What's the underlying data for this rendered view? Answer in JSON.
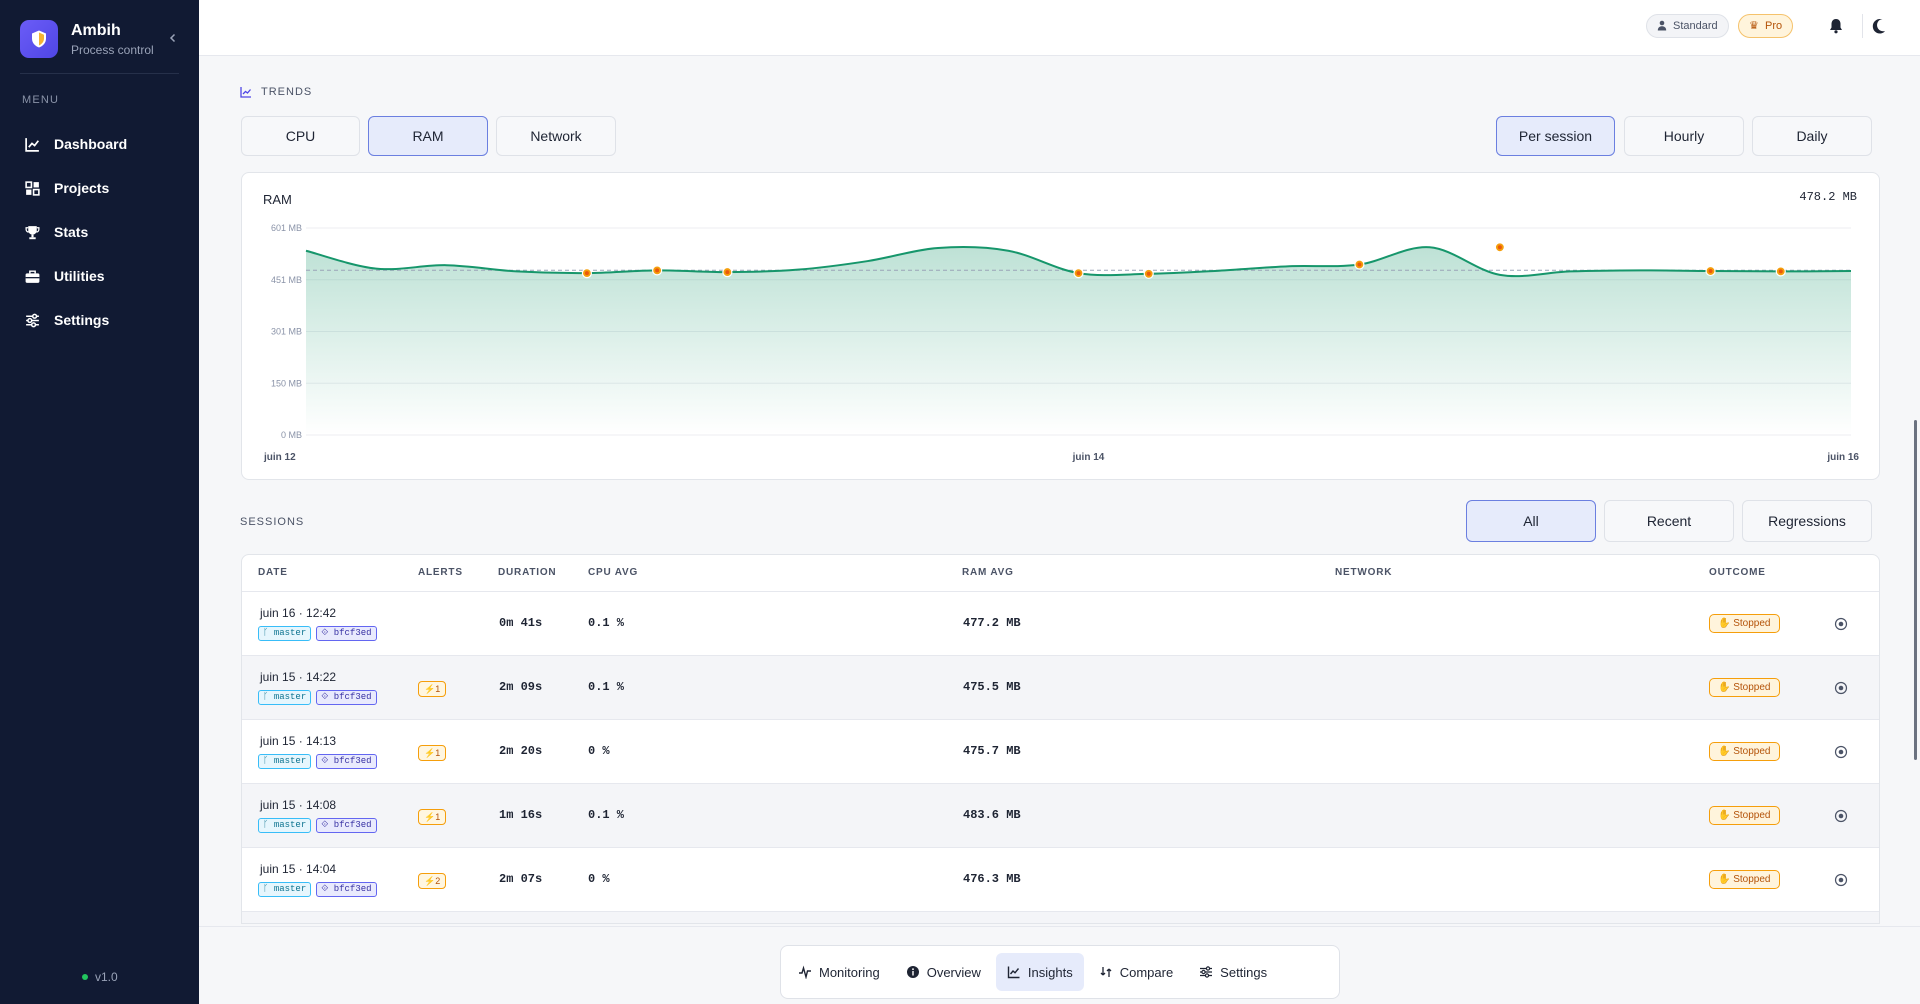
{
  "app": {
    "name": "Ambih",
    "subtitle": "Process control",
    "version": "v1.0"
  },
  "sidebar": {
    "menu_label": "MENU",
    "items": [
      {
        "label": "Dashboard",
        "icon": "chart-line-icon"
      },
      {
        "label": "Projects",
        "icon": "projects-icon"
      },
      {
        "label": "Stats",
        "icon": "trophy-icon"
      },
      {
        "label": "Utilities",
        "icon": "toolbox-icon"
      },
      {
        "label": "Settings",
        "icon": "sliders-icon"
      }
    ]
  },
  "topbar": {
    "plan_standard": "Standard",
    "plan_pro": "Pro"
  },
  "trends": {
    "label": "TRENDS",
    "metric_tabs": [
      "CPU",
      "RAM",
      "Network"
    ],
    "active_metric": "RAM",
    "period_tabs": [
      "Per session",
      "Hourly",
      "Daily"
    ],
    "active_period": "Per session"
  },
  "chart_data": {
    "type": "area",
    "title": "RAM",
    "current_value": "478.2 MB",
    "y_tick_labels": [
      "601 MB",
      "451 MB",
      "301 MB",
      "150 MB",
      "0 MB"
    ],
    "ylim": [
      0,
      601
    ],
    "x_tick_labels": [
      "juin 12",
      "juin 14",
      "juin 16"
    ],
    "grid": true,
    "reference_line": 478.2,
    "series": [
      {
        "values": [
          535,
          483,
          493,
          475,
          470,
          478,
          473,
          480,
          505,
          543,
          535,
          470,
          468,
          477,
          490,
          495,
          545,
          465,
          475,
          478,
          476,
          475,
          476
        ]
      }
    ],
    "alert_points": [
      {
        "index": 4,
        "value": 470
      },
      {
        "index": 5,
        "value": 478
      },
      {
        "index": 6,
        "value": 473
      },
      {
        "index": 11,
        "value": 470
      },
      {
        "index": 12,
        "value": 468
      },
      {
        "index": 15,
        "value": 495
      },
      {
        "index": 17,
        "value": 545
      },
      {
        "index": 20,
        "value": 476
      },
      {
        "index": 21,
        "value": 475
      }
    ],
    "color": "#16966b"
  },
  "sessions": {
    "label": "SESSIONS",
    "filter_tabs": [
      "All",
      "Recent",
      "Regressions"
    ],
    "active_filter": "All",
    "columns": [
      "DATE",
      "ALERTS",
      "DURATION",
      "CPU AVG",
      "RAM AVG",
      "NETWORK",
      "OUTCOME"
    ],
    "rows": [
      {
        "date": "juin 16 · 12:42",
        "branch": "master",
        "commit": "bfcf3ed",
        "alerts": "",
        "duration": "0m 41s",
        "cpu": "0.1 %",
        "ram": "477.2 MB",
        "network": "",
        "outcome": "Stopped"
      },
      {
        "date": "juin 15 · 14:22",
        "branch": "master",
        "commit": "bfcf3ed",
        "alerts": "1",
        "duration": "2m 09s",
        "cpu": "0.1 %",
        "ram": "475.5 MB",
        "network": "",
        "outcome": "Stopped"
      },
      {
        "date": "juin 15 · 14:13",
        "branch": "master",
        "commit": "bfcf3ed",
        "alerts": "1",
        "duration": "2m 20s",
        "cpu": "0 %",
        "ram": "475.7 MB",
        "network": "",
        "outcome": "Stopped"
      },
      {
        "date": "juin 15 · 14:08",
        "branch": "master",
        "commit": "bfcf3ed",
        "alerts": "1",
        "duration": "1m 16s",
        "cpu": "0.1 %",
        "ram": "483.6 MB",
        "network": "",
        "outcome": "Stopped"
      },
      {
        "date": "juin 15 · 14:04",
        "branch": "master",
        "commit": "bfcf3ed",
        "alerts": "2",
        "duration": "2m 07s",
        "cpu": "0 %",
        "ram": "476.3 MB",
        "network": "",
        "outcome": "Stopped"
      }
    ]
  },
  "dock": {
    "items": [
      {
        "label": "Monitoring",
        "icon": "pulse-icon"
      },
      {
        "label": "Overview",
        "icon": "info-icon"
      },
      {
        "label": "Insights",
        "icon": "chart-line-icon"
      },
      {
        "label": "Compare",
        "icon": "compare-icon"
      },
      {
        "label": "Settings",
        "icon": "sliders-icon"
      }
    ],
    "active": "Insights"
  },
  "colors": {
    "sidebar_bg": "#111a33",
    "accent": "#4f46e5",
    "chart_line": "#16966b",
    "alert": "#f59e0b"
  }
}
